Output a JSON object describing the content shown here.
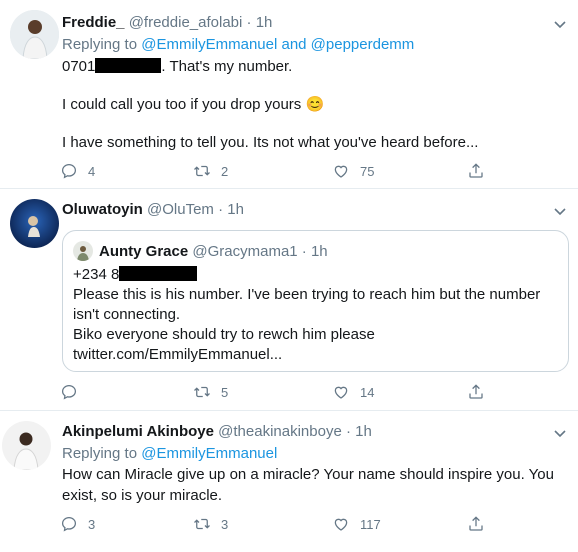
{
  "tweets": [
    {
      "name": "Freddie_",
      "handle": "@freddie_afolabi",
      "sep": "·",
      "time": "1h",
      "replying_prefix": "Replying to",
      "replying_handles": "@EmmilyEmmanuel and @pepperdemm",
      "phone_prefix": "0701",
      "phone_suffix": ". That's my number.",
      "line2": "I could call you too if you drop yours",
      "emoji": "😊",
      "line3": "I have something to tell you. Its not what you've heard before...",
      "replies": "4",
      "retweets": "2",
      "likes": "75"
    },
    {
      "name": "Oluwatoyin",
      "handle": "@OluTem",
      "sep": "·",
      "time": "1h",
      "quote": {
        "name": "Aunty Grace",
        "handle": "@Gracymama1",
        "sep": "·",
        "time": "1h",
        "phone_prefix": "+234 8",
        "line1": "Please this is his number. I've been trying to reach him but the number isn't connecting.",
        "line2": "Biko everyone should try to rewch him please",
        "line3": "twitter.com/EmmilyEmmanuel..."
      },
      "replies": "",
      "retweets": "5",
      "likes": "14"
    },
    {
      "name": "Akinpelumi Akinboye",
      "handle": "@theakinakinboye",
      "sep": "·",
      "time": "1h",
      "replying_prefix": "Replying to",
      "replying_handles": "@EmmilyEmmanuel",
      "text": "How can Miracle give up on a miracle? Your name should inspire you. You exist, so is your miracle.",
      "replies": "3",
      "retweets": "3",
      "likes": "117"
    }
  ],
  "colors": {
    "link": "#1b95e0",
    "secondary": "#657786",
    "text": "#14171a",
    "divider": "#e6ecf0"
  },
  "icons": [
    "reply-icon",
    "retweet-icon",
    "like-icon",
    "share-icon",
    "chevron-down-icon"
  ]
}
